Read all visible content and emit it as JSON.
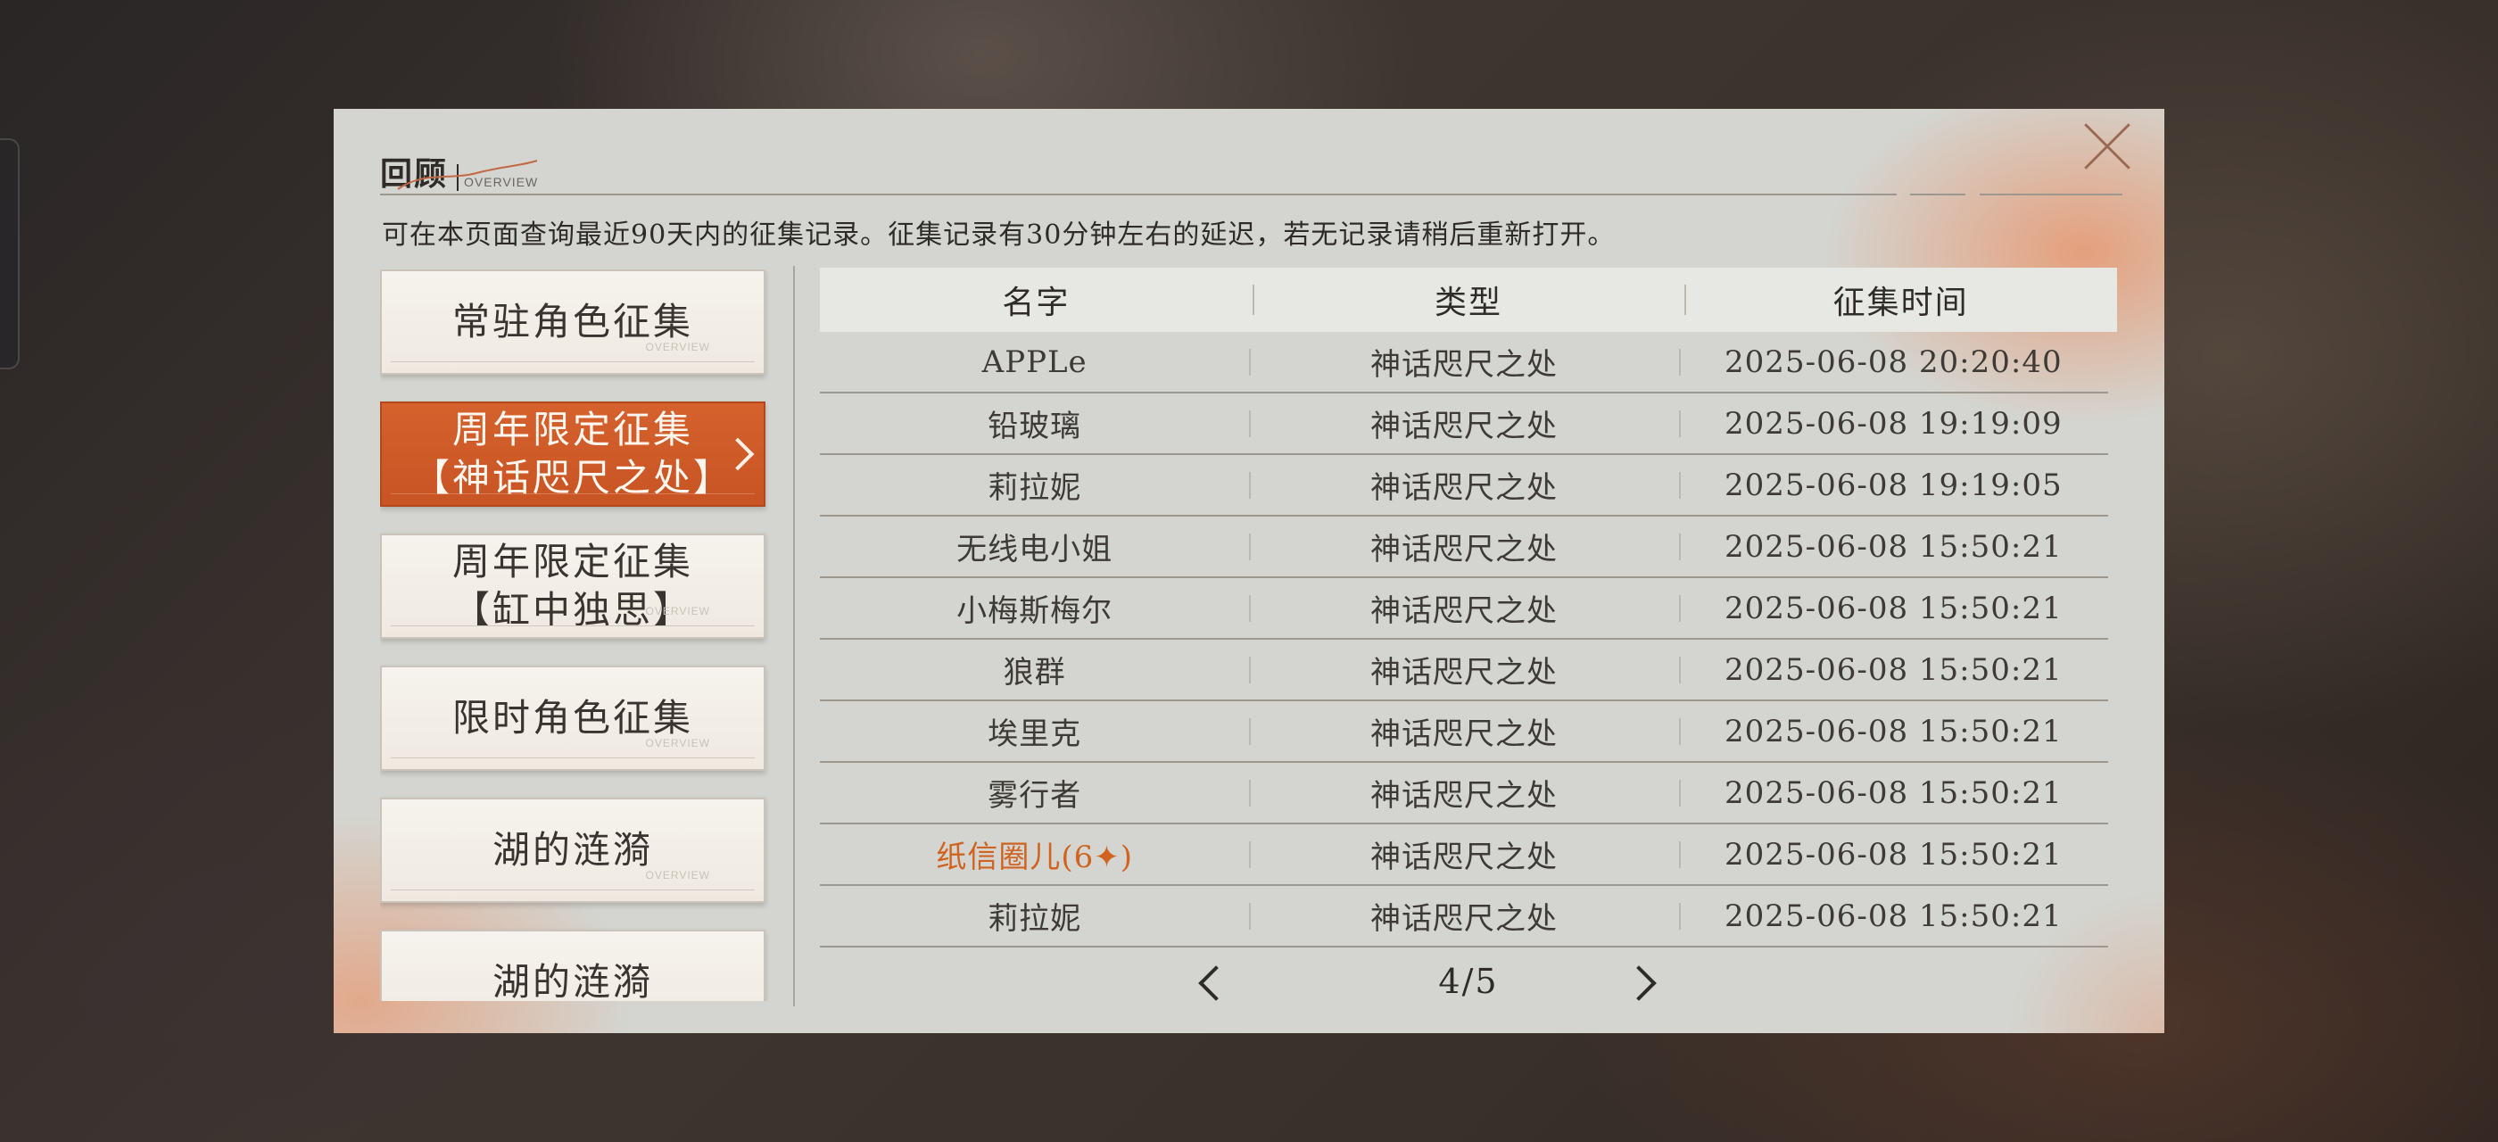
{
  "dialog": {
    "title": "回顾",
    "subtitle": "OVERVIEW",
    "notice": "可在本页面查询最近90天内的征集记录。征集记录有30分钟左右的延迟，若无记录请稍后重新打开。"
  },
  "categories": [
    {
      "label": "常驻角色征集",
      "active": false
    },
    {
      "label": "周年限定征集\n【神话咫尺之处】",
      "active": true
    },
    {
      "label": "周年限定征集\n【缸中独思】",
      "active": false
    },
    {
      "label": "限时角色征集",
      "active": false
    },
    {
      "label": "湖的涟漪",
      "active": false
    },
    {
      "label": "湖的涟漪",
      "active": false
    }
  ],
  "category_mark": "OVERVIEW",
  "table": {
    "headers": [
      "名字",
      "类型",
      "征集时间"
    ],
    "rows": [
      {
        "name": "APPLe",
        "type": "神话咫尺之处",
        "time": "2025-06-08 20:20:40",
        "highlight": false
      },
      {
        "name": "铅玻璃",
        "type": "神话咫尺之处",
        "time": "2025-06-08 19:19:09",
        "highlight": false
      },
      {
        "name": "莉拉妮",
        "type": "神话咫尺之处",
        "time": "2025-06-08 19:19:05",
        "highlight": false
      },
      {
        "name": "无线电小姐",
        "type": "神话咫尺之处",
        "time": "2025-06-08 15:50:21",
        "highlight": false
      },
      {
        "name": "小梅斯梅尔",
        "type": "神话咫尺之处",
        "time": "2025-06-08 15:50:21",
        "highlight": false
      },
      {
        "name": "狼群",
        "type": "神话咫尺之处",
        "time": "2025-06-08 15:50:21",
        "highlight": false
      },
      {
        "name": "埃里克",
        "type": "神话咫尺之处",
        "time": "2025-06-08 15:50:21",
        "highlight": false
      },
      {
        "name": "雾行者",
        "type": "神话咫尺之处",
        "time": "2025-06-08 15:50:21",
        "highlight": false
      },
      {
        "name": "纸信圈儿(6✦)",
        "type": "神话咫尺之处",
        "time": "2025-06-08 15:50:21",
        "highlight": true
      },
      {
        "name": "莉拉妮",
        "type": "神话咫尺之处",
        "time": "2025-06-08 15:50:21",
        "highlight": false
      }
    ]
  },
  "pager": {
    "label": "4/5"
  },
  "colors": {
    "accent": "#d5612d",
    "highlight_text": "#d0631f",
    "panel": "#d4d5d0"
  }
}
